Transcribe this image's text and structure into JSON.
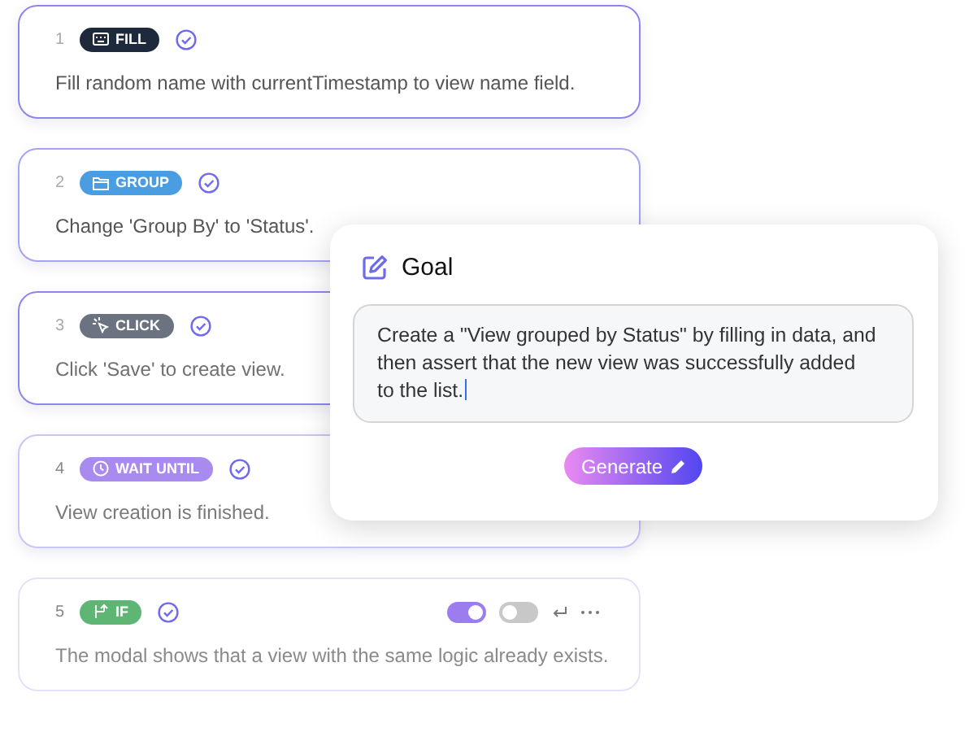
{
  "steps": [
    {
      "number": "1",
      "kind": "fill",
      "tag": "FILL",
      "color": "#1e293b",
      "description": "Fill random name with currentTimestamp to view name field."
    },
    {
      "number": "2",
      "kind": "group",
      "tag": "GROUP",
      "color": "#4a9de0",
      "description": "Change 'Group By' to 'Status'."
    },
    {
      "number": "3",
      "kind": "click",
      "tag": "CLICK",
      "color": "#6b7280",
      "description": "Click 'Save' to create view."
    },
    {
      "number": "4",
      "kind": "wait",
      "tag": "WAIT UNTIL",
      "color": "#a98bef",
      "description": "View creation is finished."
    },
    {
      "number": "5",
      "kind": "if",
      "tag": "IF",
      "color": "#5fb574",
      "description": "The modal shows that a view with the same logic already exists.",
      "toggles": [
        {
          "on": true
        },
        {
          "on": false
        }
      ]
    }
  ],
  "goal": {
    "title": "Goal",
    "text": "Create a \"View grouped by Status\" by filling in data, and then assert that the new view was successfully added to the list.",
    "button": "Generate"
  }
}
